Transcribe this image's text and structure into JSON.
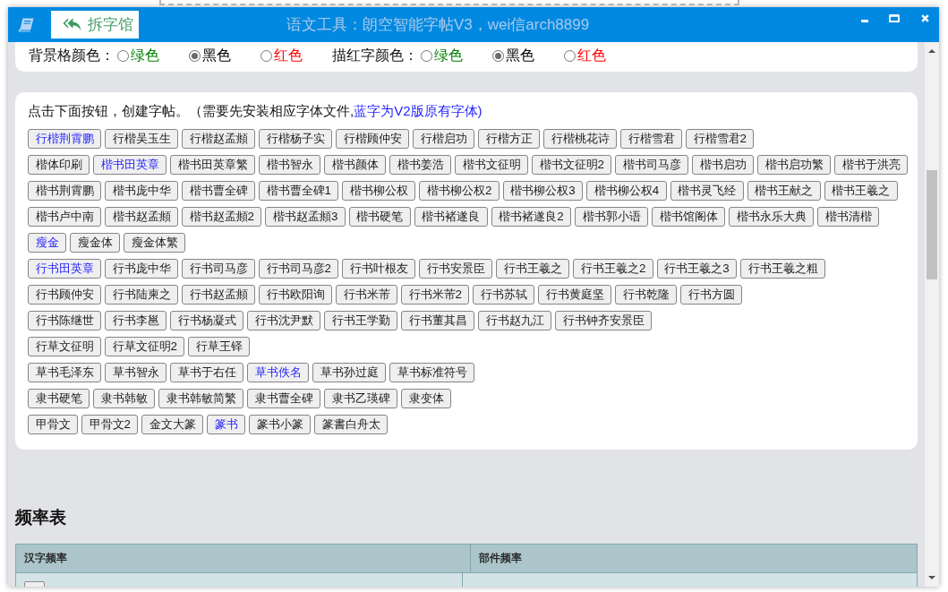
{
  "window": {
    "title": "语文工具：朗空智能字帖V3，wei信arch8899",
    "app_name": "拆字馆"
  },
  "color_settings": [
    {
      "label": "背景格颜色：",
      "options": [
        {
          "text": "绿色",
          "color": "#008000",
          "selected": false
        },
        {
          "text": "黑色",
          "color": "#000000",
          "selected": true
        },
        {
          "text": "红色",
          "color": "#ff0000",
          "selected": false
        }
      ]
    },
    {
      "label": "描红字颜色：",
      "options": [
        {
          "text": "绿色",
          "color": "#008000",
          "selected": false
        },
        {
          "text": "黑色",
          "color": "#000000",
          "selected": true
        },
        {
          "text": "红色",
          "color": "#ff0000",
          "selected": false
        }
      ]
    }
  ],
  "font_panel": {
    "intro": "点击下面按钮，创建字帖。（需要先安装相应字体文件,",
    "note": "蓝字为V2版原有字体)",
    "button_rows": [
      [
        {
          "label": "行楷荆霄鹏",
          "v2_font": true
        },
        {
          "label": "行楷吴玉生",
          "v2_font": false
        },
        {
          "label": "行楷赵孟頫",
          "v2_font": false
        },
        {
          "label": "行楷杨子实",
          "v2_font": false
        },
        {
          "label": "行楷顾仲安",
          "v2_font": false
        },
        {
          "label": "行楷启功",
          "v2_font": false
        },
        {
          "label": "行楷方正",
          "v2_font": false
        },
        {
          "label": "行楷桃花诗",
          "v2_font": false
        },
        {
          "label": "行楷雪君",
          "v2_font": false
        },
        {
          "label": "行楷雪君2",
          "v2_font": false
        }
      ],
      [
        {
          "label": "楷体印刷",
          "v2_font": false
        },
        {
          "label": "楷书田英章",
          "v2_font": true
        },
        {
          "label": "楷书田英章繁",
          "v2_font": false
        },
        {
          "label": "楷书智永",
          "v2_font": false
        },
        {
          "label": "楷书颜体",
          "v2_font": false
        },
        {
          "label": "楷书姜浩",
          "v2_font": false
        },
        {
          "label": "楷书文征明",
          "v2_font": false
        },
        {
          "label": "楷书文征明2",
          "v2_font": false
        },
        {
          "label": "楷书司马彦",
          "v2_font": false
        },
        {
          "label": "楷书启功",
          "v2_font": false
        },
        {
          "label": "楷书启功繁",
          "v2_font": false
        },
        {
          "label": "楷书于洪亮",
          "v2_font": false
        }
      ],
      [
        {
          "label": "楷书荆霄鹏",
          "v2_font": false
        },
        {
          "label": "楷书庞中华",
          "v2_font": false
        },
        {
          "label": "楷书曹全碑",
          "v2_font": false
        },
        {
          "label": "楷书曹全碑1",
          "v2_font": false
        },
        {
          "label": "楷书柳公权",
          "v2_font": false
        },
        {
          "label": "楷书柳公权2",
          "v2_font": false
        },
        {
          "label": "楷书柳公权3",
          "v2_font": false
        },
        {
          "label": "楷书柳公权4",
          "v2_font": false
        },
        {
          "label": "楷书灵飞经",
          "v2_font": false
        },
        {
          "label": "楷书王献之",
          "v2_font": false
        },
        {
          "label": "楷书王羲之",
          "v2_font": false
        }
      ],
      [
        {
          "label": "楷书卢中南",
          "v2_font": false
        },
        {
          "label": "楷书赵孟頫",
          "v2_font": false
        },
        {
          "label": "楷书赵孟頫2",
          "v2_font": false
        },
        {
          "label": "楷书赵孟頫3",
          "v2_font": false
        },
        {
          "label": "楷书硬笔",
          "v2_font": false
        },
        {
          "label": "楷书褚遂良",
          "v2_font": false
        },
        {
          "label": "楷书褚遂良2",
          "v2_font": false
        },
        {
          "label": "楷书郭小语",
          "v2_font": false
        },
        {
          "label": "楷书馆阁体",
          "v2_font": false
        },
        {
          "label": "楷书永乐大典",
          "v2_font": false
        },
        {
          "label": "楷书清楷",
          "v2_font": false
        }
      ],
      [
        {
          "label": "瘦金",
          "v2_font": true
        },
        {
          "label": "瘦金体",
          "v2_font": false
        },
        {
          "label": "瘦金体繁",
          "v2_font": false
        }
      ],
      [
        {
          "label": "行书田英章",
          "v2_font": true
        },
        {
          "label": "行书庞中华",
          "v2_font": false
        },
        {
          "label": "行书司马彦",
          "v2_font": false
        },
        {
          "label": "行书司马彦2",
          "v2_font": false
        },
        {
          "label": "行书叶根友",
          "v2_font": false
        },
        {
          "label": "行书安景臣",
          "v2_font": false
        },
        {
          "label": "行书王羲之",
          "v2_font": false
        },
        {
          "label": "行书王羲之2",
          "v2_font": false
        },
        {
          "label": "行书王羲之3",
          "v2_font": false
        },
        {
          "label": "行书王羲之粗",
          "v2_font": false
        }
      ],
      [
        {
          "label": "行书顾仲安",
          "v2_font": false
        },
        {
          "label": "行书陆柬之",
          "v2_font": false
        },
        {
          "label": "行书赵孟頫",
          "v2_font": false
        },
        {
          "label": "行书欧阳询",
          "v2_font": false
        },
        {
          "label": "行书米芾",
          "v2_font": false
        },
        {
          "label": "行书米芾2",
          "v2_font": false
        },
        {
          "label": "行书苏轼",
          "v2_font": false
        },
        {
          "label": "行书黄庭坚",
          "v2_font": false
        },
        {
          "label": "行书乾隆",
          "v2_font": false
        },
        {
          "label": "行书方圆",
          "v2_font": false
        }
      ],
      [
        {
          "label": "行书陈继世",
          "v2_font": false
        },
        {
          "label": "行书李邕",
          "v2_font": false
        },
        {
          "label": "行书杨凝式",
          "v2_font": false
        },
        {
          "label": "行书沈尹默",
          "v2_font": false
        },
        {
          "label": "行书王学勤",
          "v2_font": false
        },
        {
          "label": "行书董其昌",
          "v2_font": false
        },
        {
          "label": "行书赵九江",
          "v2_font": false
        },
        {
          "label": "行书钟齐安景臣",
          "v2_font": false
        }
      ],
      [
        {
          "label": "行草文征明",
          "v2_font": false
        },
        {
          "label": "行草文征明2",
          "v2_font": false
        },
        {
          "label": "行草王铎",
          "v2_font": false
        }
      ],
      [
        {
          "label": "草书毛泽东",
          "v2_font": false
        },
        {
          "label": "草书智永",
          "v2_font": false
        },
        {
          "label": "草书于右任",
          "v2_font": false
        },
        {
          "label": "草书佚名",
          "v2_font": true
        },
        {
          "label": "草书孙过庭",
          "v2_font": false
        },
        {
          "label": "草书标准符号",
          "v2_font": false
        }
      ],
      [
        {
          "label": "隶书硬笔",
          "v2_font": false
        },
        {
          "label": "隶书韩敏",
          "v2_font": false
        },
        {
          "label": "隶书韩敏简繁",
          "v2_font": false
        },
        {
          "label": "隶书曹全碑",
          "v2_font": false
        },
        {
          "label": "隶书乙瑛碑",
          "v2_font": false
        },
        {
          "label": "隶变体",
          "v2_font": false
        }
      ],
      [
        {
          "label": "甲骨文",
          "v2_font": false
        },
        {
          "label": "甲骨文2",
          "v2_font": false
        },
        {
          "label": "金文大篆",
          "v2_font": false
        },
        {
          "label": "篆书",
          "v2_font": true
        },
        {
          "label": "篆书小篆",
          "v2_font": false
        },
        {
          "label": "篆書白舟太",
          "v2_font": false
        }
      ]
    ]
  },
  "frequency_section": {
    "heading": "频率表",
    "table": {
      "columns": [
        "汉字频率",
        "部件频率"
      ]
    }
  }
}
